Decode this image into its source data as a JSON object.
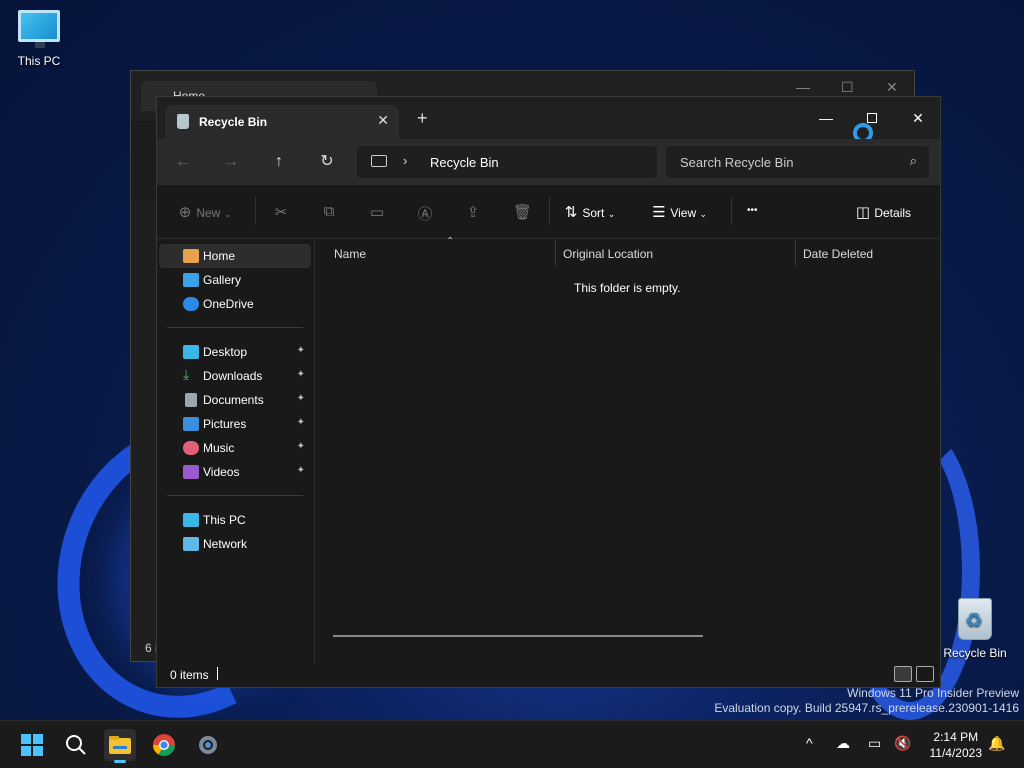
{
  "desktop": {
    "this_pc_label": "This PC",
    "recycle_bin_label": "Recycle Bin",
    "watermark_line1": "Windows 11 Pro Insider Preview",
    "watermark_line2": "Evaluation copy. Build 25947.rs_prerelease.230901-1416"
  },
  "background_window": {
    "tab_title": "Home",
    "footer_text": "6 i"
  },
  "window": {
    "tab_title": "Recycle Bin",
    "tab_close": "✕",
    "new_tab": "+",
    "minimize": "—",
    "close": "✕"
  },
  "navbar": {
    "back": "←",
    "forward": "→",
    "up": "↑",
    "refresh": "↻",
    "chevron": "›",
    "address_path": "Recycle Bin",
    "search_placeholder": "Search Recycle Bin",
    "search_glyph": "⌕"
  },
  "toolbar": {
    "new_label": "New",
    "sort_label": "Sort",
    "view_label": "View",
    "more_label": "•••",
    "details_label": "Details",
    "icons": [
      "cut-icon",
      "copy-icon",
      "paste-icon",
      "rename-icon",
      "share-icon",
      "delete-icon"
    ]
  },
  "sidebar": {
    "top": [
      {
        "label": "Home",
        "icon": "home-icon",
        "color": "#e8a04a"
      },
      {
        "label": "Gallery",
        "icon": "gallery-icon",
        "color": "#3aa0e8"
      },
      {
        "label": "OneDrive",
        "icon": "onedrive-icon",
        "color": "#2b8ae6"
      }
    ],
    "pinned": [
      {
        "label": "Desktop",
        "icon": "desktop-icon",
        "color": "#3bb6e8"
      },
      {
        "label": "Downloads",
        "icon": "downloads-icon",
        "color": "#3ec27a"
      },
      {
        "label": "Documents",
        "icon": "documents-icon",
        "color": "#9aa6b2"
      },
      {
        "label": "Pictures",
        "icon": "pictures-icon",
        "color": "#3a8fe0"
      },
      {
        "label": "Music",
        "icon": "music-icon",
        "color": "#e0607a"
      },
      {
        "label": "Videos",
        "icon": "videos-icon",
        "color": "#9b59d0"
      }
    ],
    "bottom": [
      {
        "label": "This PC",
        "icon": "this-pc-icon",
        "color": "#3bb6e8"
      },
      {
        "label": "Network",
        "icon": "network-icon",
        "color": "#5fb8e8"
      }
    ],
    "pin_glyph": "📌"
  },
  "content": {
    "columns": [
      "Name",
      "Original Location",
      "Date Deleted"
    ],
    "empty_message": "This folder is empty."
  },
  "statusbar": {
    "item_count": "0 items"
  },
  "taskbar": {
    "apps": [
      "start-icon",
      "search-icon",
      "file-explorer-icon",
      "chrome-icon",
      "settings-icon"
    ],
    "tray_chevron": "^",
    "time": "2:14 PM",
    "date": "11/4/2023"
  }
}
